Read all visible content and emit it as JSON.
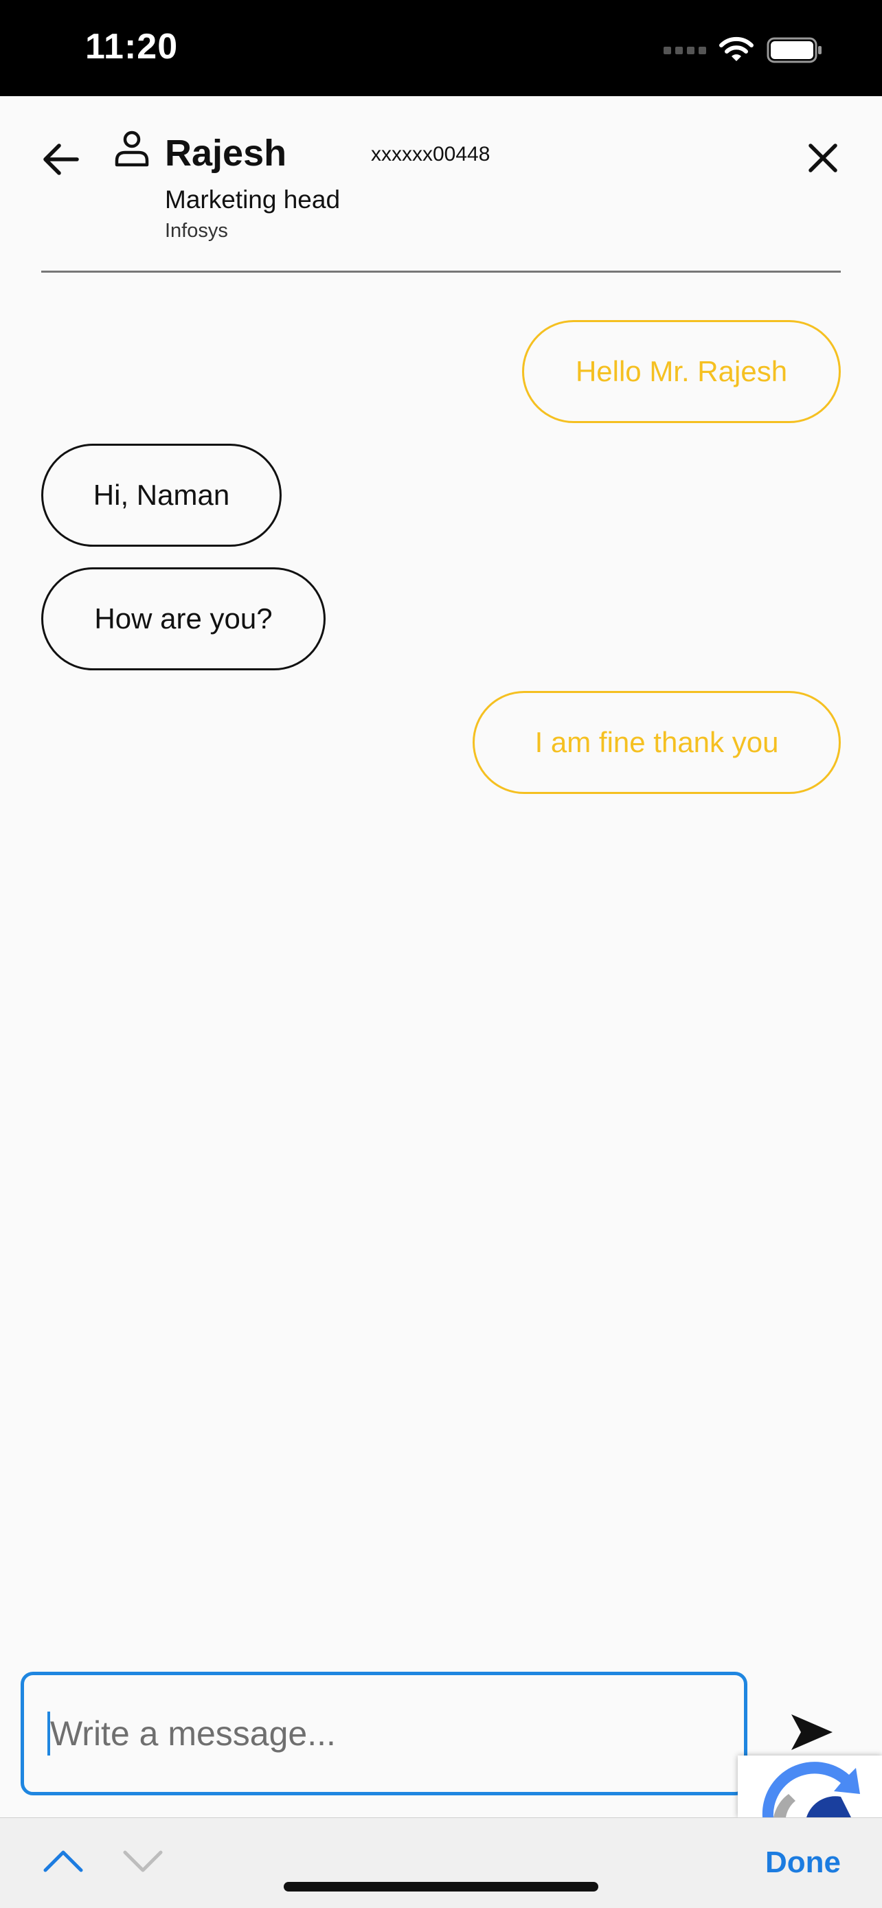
{
  "status_bar": {
    "time": "11:20"
  },
  "contact": {
    "name": "Rajesh",
    "phone": "xxxxxx00448",
    "role": "Marketing head",
    "company": "Infosys"
  },
  "messages": [
    {
      "text": "Hello Mr. Rajesh",
      "direction": "outgoing"
    },
    {
      "text": "Hi, Naman",
      "direction": "incoming"
    },
    {
      "text": "How are you?",
      "direction": "incoming"
    },
    {
      "text": "I am fine thank you",
      "direction": "outgoing"
    }
  ],
  "composer": {
    "placeholder": "Write a message..."
  },
  "keyboard_toolbar": {
    "done_label": "Done"
  },
  "colors": {
    "outgoing_bubble": "#f5c021",
    "incoming_bubble": "#111111",
    "accent": "#1f86e0"
  },
  "icons": {
    "back": "arrow-left-icon",
    "contact": "person-icon",
    "close": "close-icon",
    "send": "send-icon",
    "wifi": "wifi-icon",
    "battery": "battery-icon"
  }
}
